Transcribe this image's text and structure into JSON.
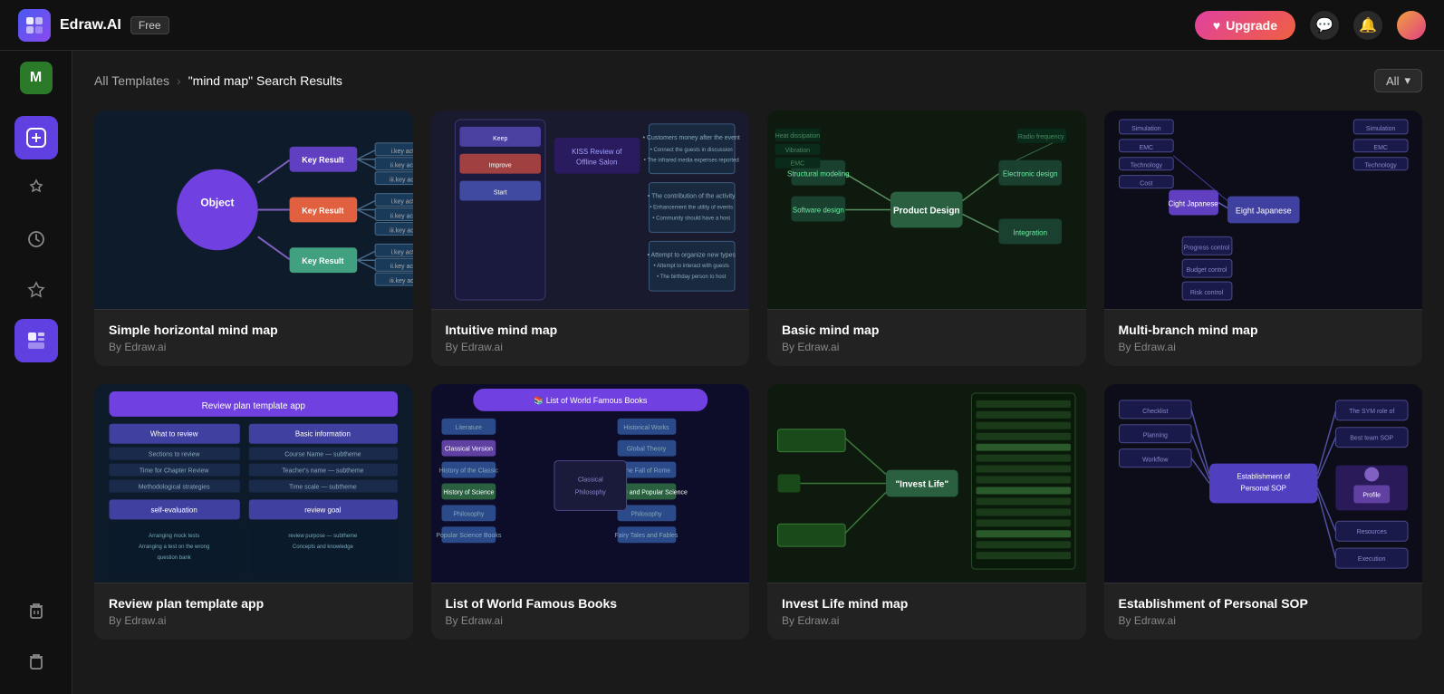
{
  "app": {
    "name": "Edraw.AI",
    "free_badge": "Free"
  },
  "topbar": {
    "upgrade_label": "Upgrade",
    "filter_label": "All"
  },
  "breadcrumb": {
    "all_templates": "All Templates",
    "separator": "›",
    "search_results": "\"mind map\" Search Results"
  },
  "sidebar": {
    "items": [
      {
        "id": "workspace",
        "icon": "M",
        "label": "workspace"
      },
      {
        "id": "create",
        "icon": "+",
        "label": "create-new"
      },
      {
        "id": "ai",
        "icon": "✦",
        "label": "ai-tools"
      },
      {
        "id": "recent",
        "icon": "🕐",
        "label": "recent"
      },
      {
        "id": "starred",
        "icon": "★",
        "label": "starred"
      },
      {
        "id": "templates",
        "icon": "📋",
        "label": "templates",
        "active": true
      },
      {
        "id": "trash1",
        "icon": "🗑",
        "label": "trash"
      },
      {
        "id": "trash2",
        "icon": "🗑",
        "label": "recycle"
      }
    ]
  },
  "templates": {
    "row1": [
      {
        "id": "simple-horizontal",
        "title": "Simple horizontal mind map",
        "author": "By Edraw.ai",
        "thumb_type": "mindmap1"
      },
      {
        "id": "intuitive",
        "title": "Intuitive mind map",
        "author": "By Edraw.ai",
        "thumb_type": "mindmap2"
      },
      {
        "id": "basic",
        "title": "Basic mind map",
        "author": "By Edraw.ai",
        "thumb_type": "mindmap3"
      },
      {
        "id": "multi-branch",
        "title": "Multi-branch mind map",
        "author": "By Edraw.ai",
        "thumb_type": "mindmap4"
      }
    ],
    "row2": [
      {
        "id": "review-plan",
        "title": "Review plan template app",
        "author": "By Edraw.ai",
        "thumb_type": "mindmap5"
      },
      {
        "id": "world-books",
        "title": "List of World Famous Books",
        "author": "By Edraw.ai",
        "thumb_type": "mindmap6"
      },
      {
        "id": "invest-life",
        "title": "Invest Life mind map",
        "author": "By Edraw.ai",
        "thumb_type": "mindmap7"
      },
      {
        "id": "personal-sop",
        "title": "Establishment of Personal SOP",
        "author": "By Edraw.ai",
        "thumb_type": "mindmap8"
      }
    ]
  }
}
